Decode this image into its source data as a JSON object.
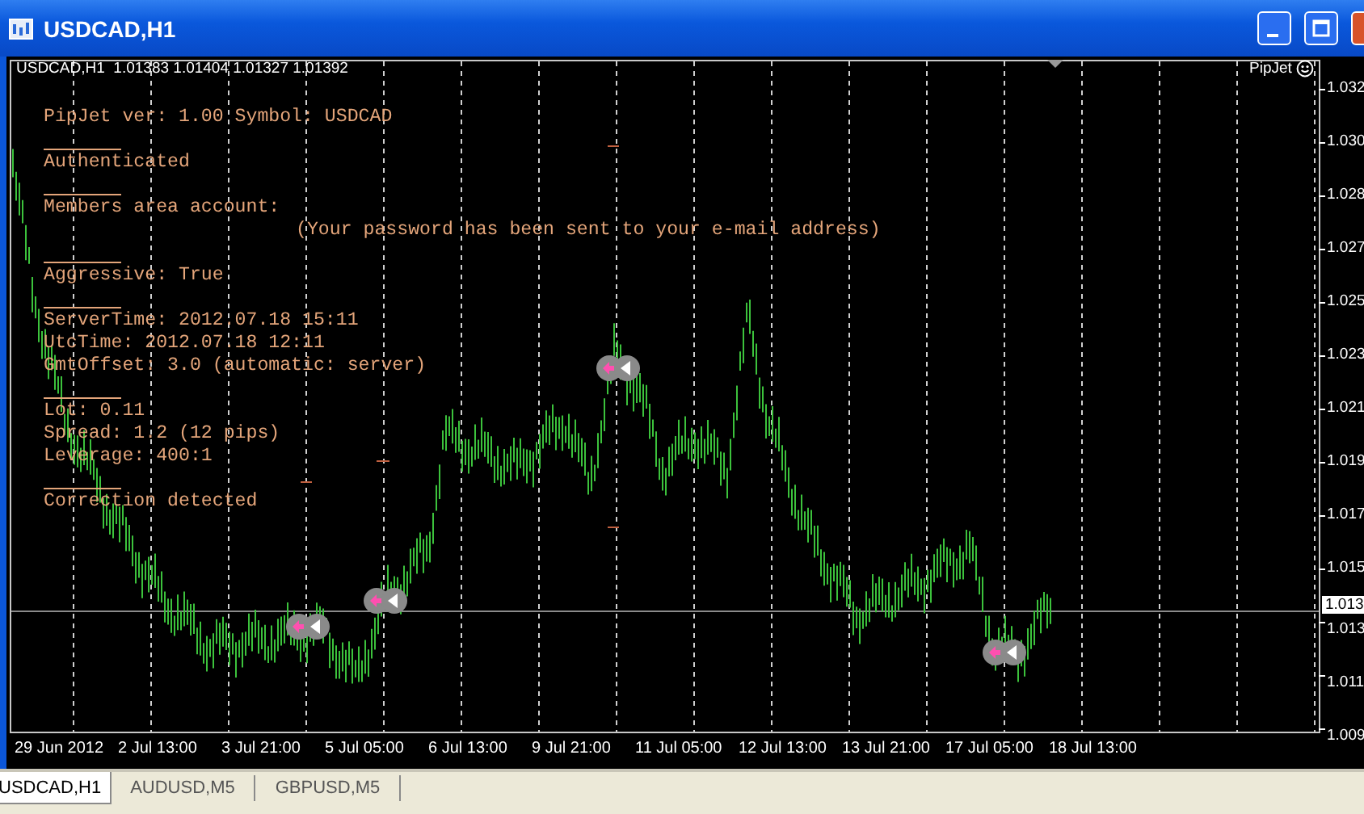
{
  "window": {
    "title": "USDCAD,H1"
  },
  "chart": {
    "header": "USDCAD,H1  1.01383 1.01404 1.01327 1.01392",
    "expert_name": "PipJet",
    "info_lines": [
      {
        "kind": "text",
        "text": "PipJet ver: 1.00 Symbol: USDCAD"
      },
      {
        "kind": "rule"
      },
      {
        "kind": "text",
        "text": "Authenticated"
      },
      {
        "kind": "rule"
      },
      {
        "kind": "text",
        "text": "Members area account:"
      },
      {
        "kind": "indented",
        "text": "(Your password has been sent to your e-mail address)"
      },
      {
        "kind": "rule"
      },
      {
        "kind": "text",
        "text": "Aggressive: True"
      },
      {
        "kind": "rule"
      },
      {
        "kind": "text",
        "text": "ServerTime: 2012.07.18 15:11"
      },
      {
        "kind": "text",
        "text": "UtcTime: 2012.07.18 12:11"
      },
      {
        "kind": "text",
        "text": "GmtOffset: 3.0 (automatic: server)"
      },
      {
        "kind": "rule"
      },
      {
        "kind": "text",
        "text": "Lot: 0.11"
      },
      {
        "kind": "text",
        "text": "Spread: 1.2 (12 pips)"
      },
      {
        "kind": "text",
        "text": "Leverage: 400:1"
      },
      {
        "kind": "rule"
      },
      {
        "kind": "text",
        "text": "Correction detected"
      }
    ],
    "price_axis": [
      "1.032",
      "1.030",
      "1.028",
      "1.027",
      "1.025",
      "1.023",
      "1.021",
      "1.019",
      "1.017",
      "1.015",
      "1.013",
      "1.011",
      "1.009"
    ],
    "current_price": "1.013",
    "time_axis": [
      "29 Jun 2012",
      "2 Jul 13:00",
      "3 Jul 21:00",
      "5 Jul 05:00",
      "6 Jul 13:00",
      "9 Jul 21:00",
      "11 Jul 05:00",
      "12 Jul 13:00",
      "13 Jul 21:00",
      "17 Jul 05:00",
      "18 Jul 13:00"
    ]
  },
  "tabs": [
    {
      "label": "USDCAD,H1",
      "selected": true
    },
    {
      "label": "AUDUSD,M5",
      "selected": false
    },
    {
      "label": "GBPUSD,M5",
      "selected": false
    }
  ]
}
